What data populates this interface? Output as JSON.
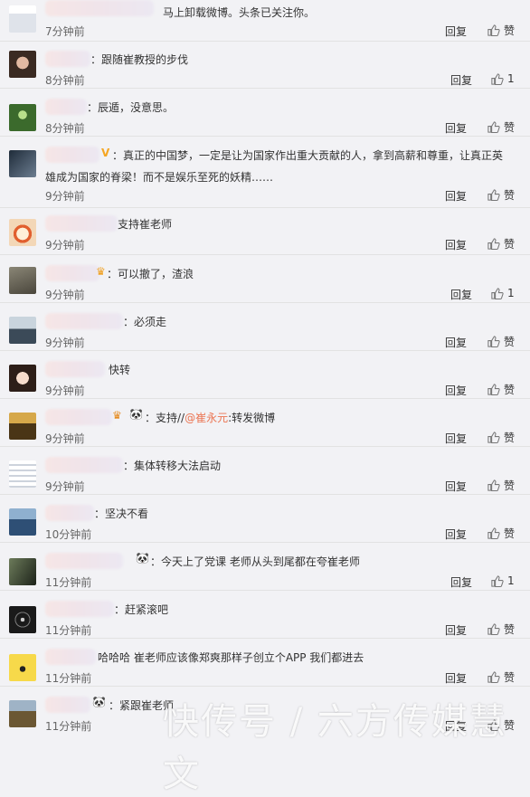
{
  "comments": [
    {
      "id": "c0",
      "name": "",
      "text": "马上卸载微博。头条已关注你。",
      "time": "7分钟前",
      "reply": "回复",
      "like": "赞",
      "avatar_color": "#cfd6e3"
    },
    {
      "id": "c1",
      "name": "",
      "text": "：跟随崔教授的步伐",
      "time": "8分钟前",
      "reply": "回复",
      "like": "1",
      "avatar_color": "#6b4d3e"
    },
    {
      "id": "c2",
      "name": "",
      "text": "：辰遁，没意思。",
      "time": "8分钟前",
      "reply": "回复",
      "like": "赞",
      "avatar_color": "#4e7f3a"
    },
    {
      "id": "c3",
      "name": "",
      "text_line1": "：真正的中国梦，一定是让为国家作出重大贡献的人，拿到高薪和尊重，让真正英",
      "text_line2": "雄成为国家的脊梁！而不是娱乐至死的妖精……",
      "time": "9分钟前",
      "reply": "回复",
      "like": "赞",
      "avatar_color": "#2a3644"
    },
    {
      "id": "c4",
      "name": "",
      "text": "支持崔老师",
      "time": "9分钟前",
      "reply": "回复",
      "like": "赞",
      "avatar_color": "#f3d7b7"
    },
    {
      "id": "c5",
      "name": "",
      "text": "：可以撤了，渣浪",
      "time": "9分钟前",
      "reply": "回复",
      "like": "1",
      "avatar_color": "#6e6a5d"
    },
    {
      "id": "c6",
      "name": "",
      "text": "：必须走",
      "time": "9分钟前",
      "reply": "回复",
      "like": "赞",
      "avatar_color": "#4f6275"
    },
    {
      "id": "c7",
      "name": "",
      "text": "快转",
      "time": "9分钟前",
      "reply": "回复",
      "like": "赞",
      "avatar_color": "#d7b7a8"
    },
    {
      "id": "c8",
      "name": "",
      "text_before": "：支持//",
      "mention": "@崔永元",
      "text_after": ":转发微博",
      "time": "9分钟前",
      "reply": "回复",
      "like": "赞",
      "avatar_color": "#8c6a2b"
    },
    {
      "id": "c9",
      "name": "",
      "text": "：集体转移大法启动",
      "time": "9分钟前",
      "reply": "回复",
      "like": "赞",
      "avatar_color": "#e6e8ee"
    },
    {
      "id": "c10",
      "name": "",
      "text": "：坚决不看",
      "time": "10分钟前",
      "reply": "回复",
      "like": "赞",
      "avatar_color": "#4d74a0"
    },
    {
      "id": "c11",
      "name": "",
      "text": "：今天上了党课  老师从头到尾都在夸崔老师",
      "time": "11分钟前",
      "reply": "回复",
      "like": "1",
      "avatar_color": "#2f3b2c"
    },
    {
      "id": "c12",
      "name": "",
      "text": "：赶紧滚吧",
      "time": "11分钟前",
      "reply": "回复",
      "like": "赞",
      "avatar_color": "#1a1a1a"
    },
    {
      "id": "c13",
      "name": "",
      "text": "哈哈哈 崔老师应该像郑爽那样子创立个APP 我们都进去",
      "time": "11分钟前",
      "reply": "回复",
      "like": "赞",
      "avatar_color": "#f7d94a"
    },
    {
      "id": "c14",
      "name": "",
      "text": "：紧跟崔老师",
      "time": "11分钟前",
      "reply": "回复",
      "like": "赞",
      "avatar_color": "#5c4b2d"
    }
  ],
  "watermark": "快传号 / 六方传媒慧文",
  "colors": {
    "mention": "#eb7350",
    "background": "#f2f2f5"
  }
}
